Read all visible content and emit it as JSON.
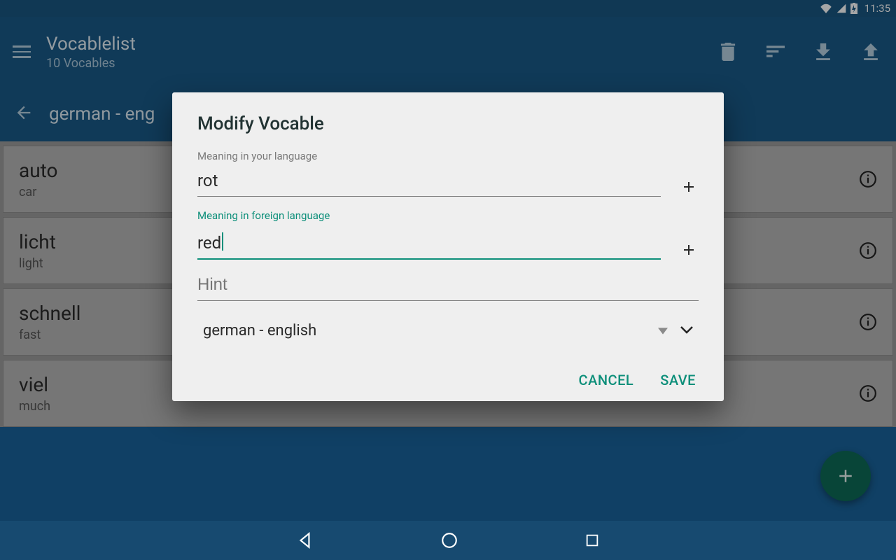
{
  "status": {
    "time": "11:35"
  },
  "appbar": {
    "title": "Vocablelist",
    "subtitle": "10 Vocables"
  },
  "subheader": {
    "title": "german - eng"
  },
  "rows": [
    {
      "word": "auto",
      "trans": "car"
    },
    {
      "word": "licht",
      "trans": "light"
    },
    {
      "word": "schnell",
      "trans": "fast"
    },
    {
      "word": "viel",
      "trans": "much"
    }
  ],
  "dialog": {
    "title": "Modify Vocable",
    "label_native": "Meaning in your language",
    "value_native": "rot",
    "label_foreign": "Meaning in foreign language",
    "value_foreign": "red",
    "hint_placeholder": "Hint",
    "select_value": "german - english",
    "cancel": "CANCEL",
    "save": "SAVE"
  }
}
